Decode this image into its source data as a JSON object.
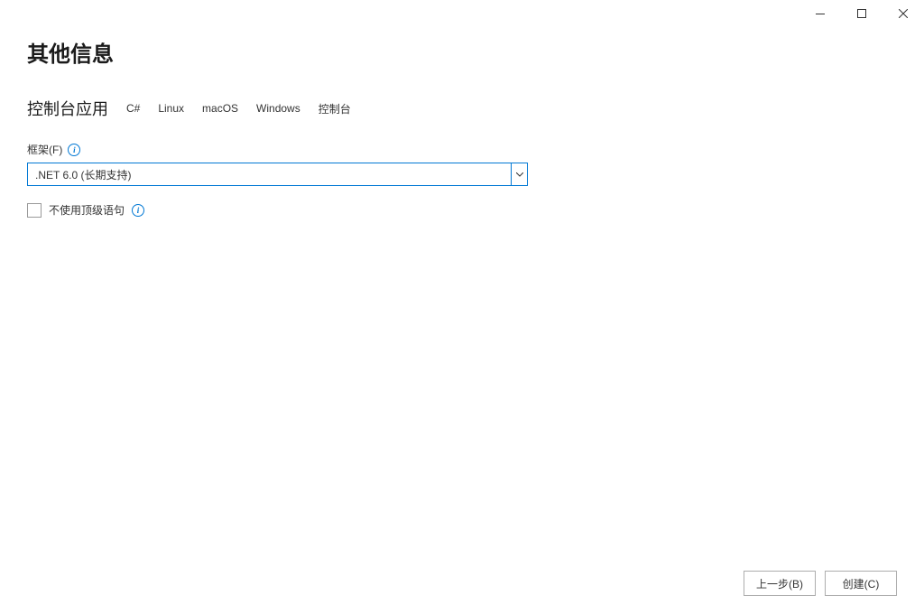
{
  "page_title": "其他信息",
  "project_type": "控制台应用",
  "tags": [
    "C#",
    "Linux",
    "macOS",
    "Windows",
    "控制台"
  ],
  "framework": {
    "label": "框架(F)",
    "selected": ".NET 6.0 (长期支持)"
  },
  "checkbox": {
    "label": "不使用顶级语句",
    "checked": false
  },
  "buttons": {
    "back": "上一步(B)",
    "create": "创建(C)"
  }
}
